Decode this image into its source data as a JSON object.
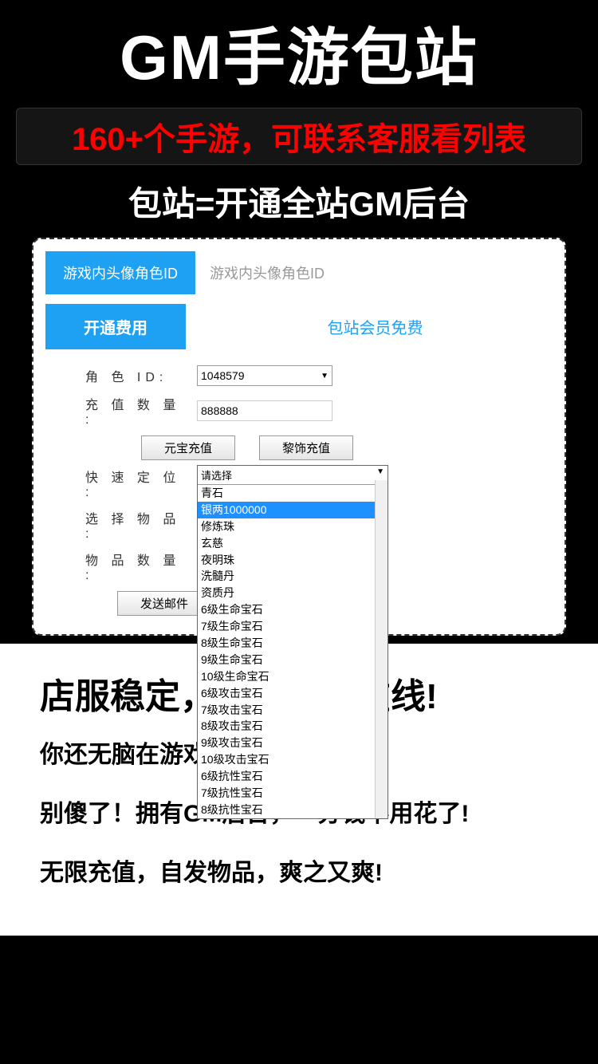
{
  "header": {
    "title": "GM手游包站",
    "subtitle_prefix": "160+",
    "subtitle_rest": "个手游，可联系客服看列表",
    "line2": "包站=开通全站GM后台"
  },
  "tabs": {
    "active": "游戏内头像角色ID",
    "placeholder": "游戏内头像角色ID"
  },
  "fee": {
    "button": "开通费用",
    "text": "包站会员免费"
  },
  "form": {
    "role_label": "角 色 ID:",
    "role_value": "1048579",
    "amount_label": "充 值 数 量 :",
    "amount_value": "888888",
    "btn_yuanbao": "元宝充值",
    "btn_lishi": "黎饰充值",
    "quick_label": "快 速 定 位 :",
    "select_label": "选 择 物 品 :",
    "select_value": "请选择",
    "item_qty_label": "物 品 数 量 :",
    "send_btn": "发送邮件"
  },
  "dropdown": {
    "header": "请选择",
    "items": [
      "青石",
      "银两1000000",
      "修炼珠",
      "玄慈",
      "夜明珠",
      "洗髓丹",
      "资质丹",
      "6级生命宝石",
      "7级生命宝石",
      "8级生命宝石",
      "9级生命宝石",
      "10级生命宝石",
      "6级攻击宝石",
      "7级攻击宝石",
      "8级攻击宝石",
      "9级攻击宝石",
      "10级攻击宝石",
      "6级抗性宝石",
      "7级抗性宝石",
      "8级抗性宝石"
    ],
    "selected_index": 1
  },
  "footer": {
    "line1": "店服稳定，百人同时在线!",
    "line2": "你还无脑在游戏充钱吗…?",
    "line3": "别傻了！拥有GM后台，一分钱不用花了!",
    "line4": "无限充值，自发物品，爽之又爽!"
  }
}
